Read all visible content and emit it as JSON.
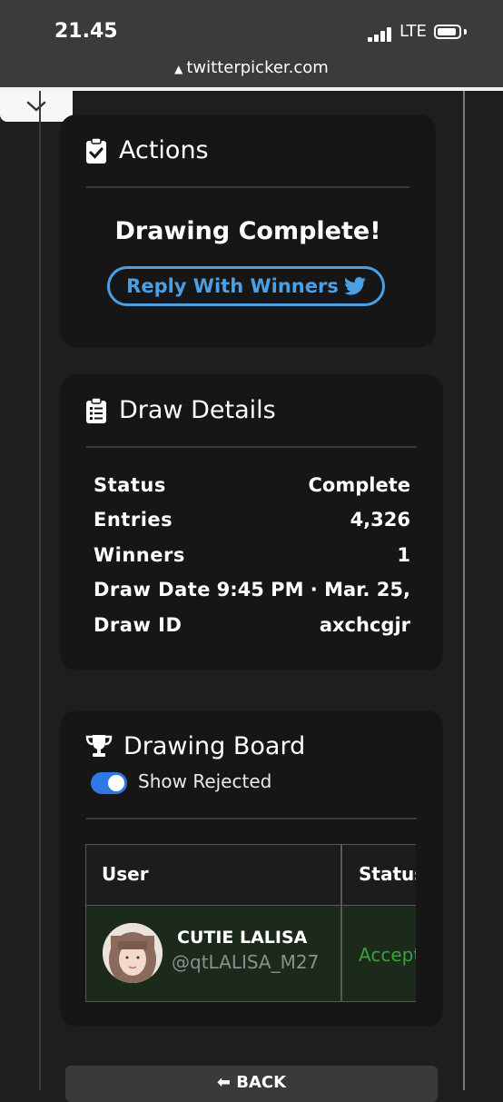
{
  "status_bar": {
    "time": "21.45",
    "network": "LTE"
  },
  "browser": {
    "url": "twitterpicker.com"
  },
  "actions_card": {
    "title": "Actions",
    "headline": "Drawing Complete!",
    "reply_button": "Reply With Winners"
  },
  "details_card": {
    "title": "Draw Details",
    "rows": [
      {
        "label": "Status",
        "value": "Complete"
      },
      {
        "label": "Entries",
        "value": "4,326"
      },
      {
        "label": "Winners",
        "value": "1"
      },
      {
        "label": "Draw Date",
        "value": "9:45 PM · Mar. 25,"
      },
      {
        "label": "Draw ID",
        "value": "axchcgjr"
      }
    ]
  },
  "board_card": {
    "title": "Drawing Board",
    "toggle_label": "Show Rejected",
    "toggle_on": true,
    "table": {
      "headers": [
        "User",
        "Status"
      ],
      "rows": [
        {
          "name": "CUTIE LALISA",
          "handle": "@qtLALISA_M27",
          "status": "Accepted"
        }
      ]
    }
  },
  "back_button": "BACK",
  "colors": {
    "accent": "#4b9fe4",
    "toggle": "#2f78e6",
    "accepted": "#3f9d3f"
  }
}
